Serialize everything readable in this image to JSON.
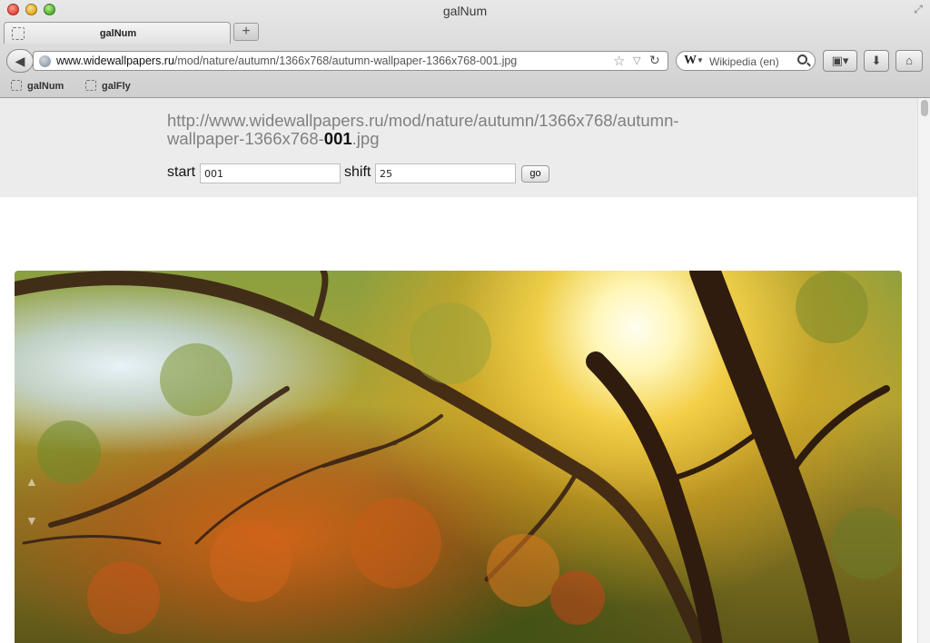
{
  "window": {
    "title": "galNum"
  },
  "tab": {
    "label": "galNum",
    "new_tab_symbol": "+"
  },
  "toolbar": {
    "url_host": "www.widewallpapers.ru",
    "url_path": "/mod/nature/autumn/1366x768/autumn-wallpaper-1366x768-001.jpg",
    "search_engine_letter": "W",
    "search_placeholder": "Wikipedia (en)"
  },
  "bookmarks": [
    {
      "label": "galNum"
    },
    {
      "label": "galFly"
    }
  ],
  "page": {
    "url_prefix": "http://www.widewallpapers.ru/mod/nature/autumn/1366x768/autumn-wallpaper-1366x768-",
    "url_number": "001",
    "url_suffix": ".jpg",
    "start_label": "start",
    "start_value": "001",
    "shift_label": "shift",
    "shift_value": "25",
    "go_label": "go"
  },
  "icons": {
    "back": "back-arrow-icon",
    "globe": "globe-icon",
    "star": "star-icon",
    "reload": "reload-icon",
    "search": "search-icon",
    "screenshot": "screenshot-icon",
    "download": "download-icon",
    "home": "home-icon"
  },
  "colors": {
    "header_panel": "#ececec",
    "url_gray": "#808080",
    "url_bold": "#111111"
  }
}
